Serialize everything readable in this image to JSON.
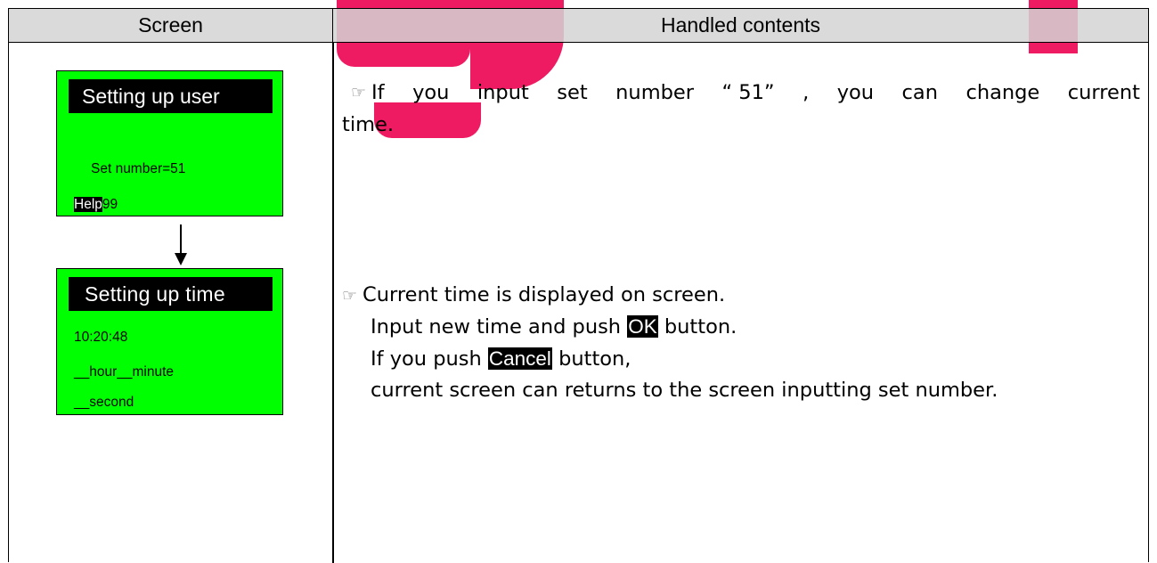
{
  "table": {
    "header_screen": "Screen",
    "header_contents": "Handled contents"
  },
  "screen1": {
    "title": "Setting up user",
    "set_number": "Set number=51",
    "help_label": "Help",
    "help_value": "99"
  },
  "screen2": {
    "title": "Setting up time",
    "time_value": "10:20:48",
    "hour_minute": "__hour__minute",
    "second": "__second"
  },
  "content": {
    "pointer_icon": "☞",
    "para1_words": [
      "If",
      "you",
      "input",
      "set",
      "number",
      "“ 51”",
      ",",
      "you",
      "can",
      "change",
      "current"
    ],
    "para1_line2": "time.",
    "para2_line1": "Current time is displayed on screen.",
    "para2_line2_pre": "Input new time and push ",
    "ok_key": "OK",
    "para2_line2_post": " button.",
    "para2_line3_pre": "If you push ",
    "cancel_key": "Cancel",
    "para2_line3_post": " button,",
    "para2_line4": "current screen can returns to the screen inputting set number."
  },
  "colors": {
    "lcd_green": "#00ff00",
    "header_gray": "#d4d4d4",
    "watermark_pink": "#ee1b63"
  }
}
